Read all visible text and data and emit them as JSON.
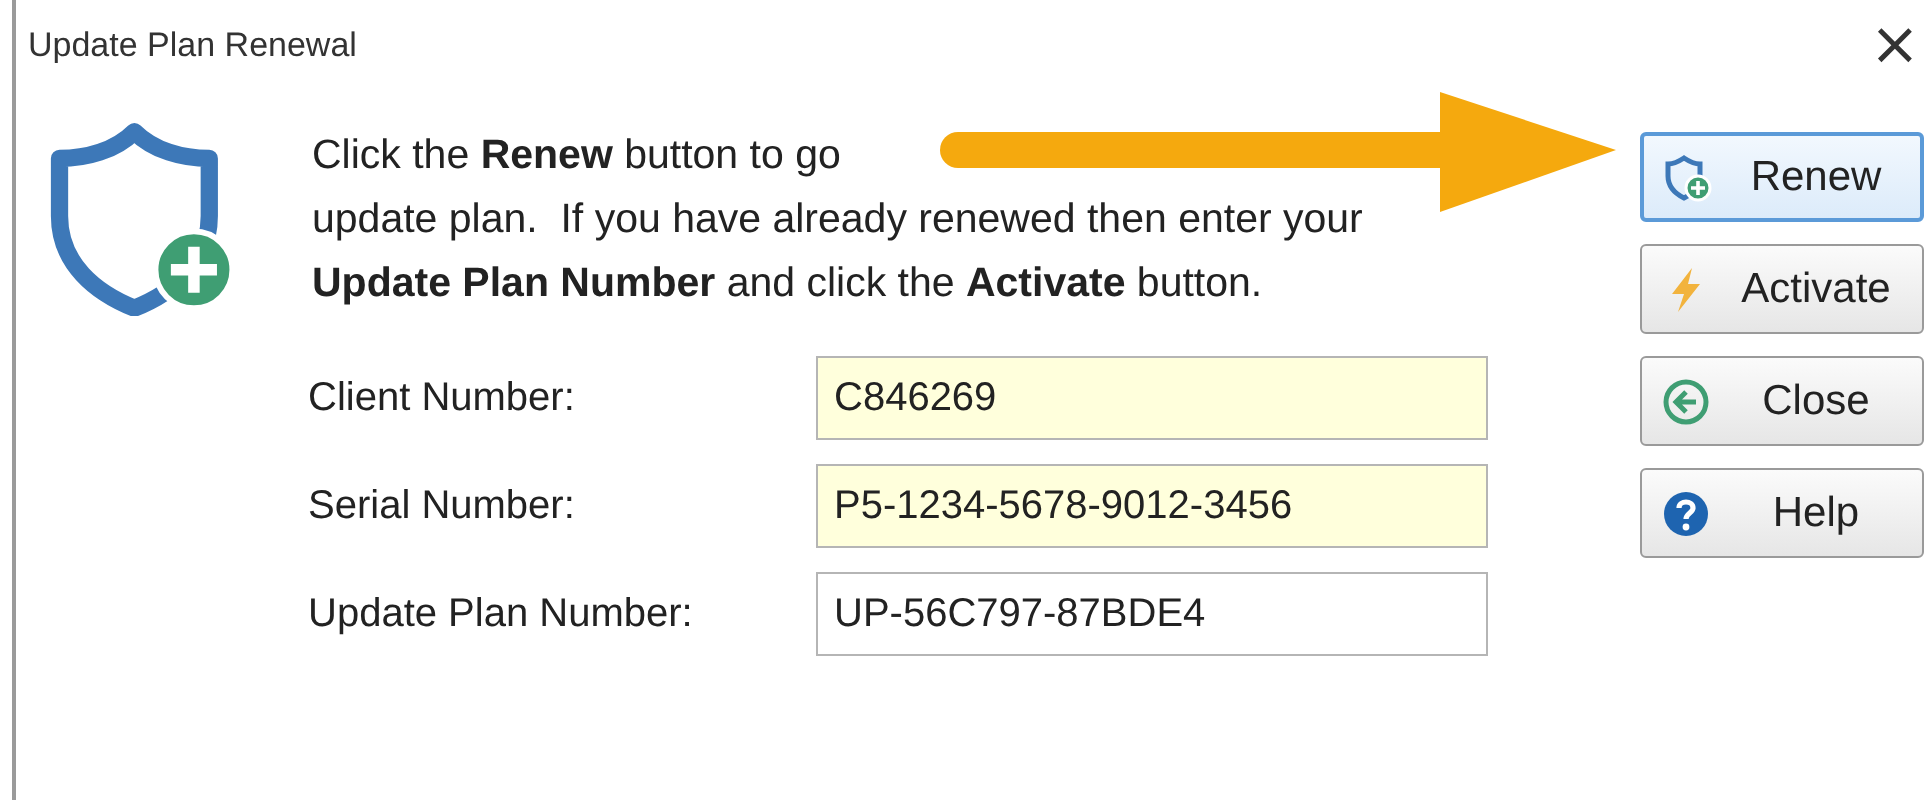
{
  "window": {
    "title": "Update Plan Renewal",
    "close": "×"
  },
  "message": [
    "Click the **Renew** button to go",
    "update plan.  If you have already renewed then enter your",
    "**Update Plan Number** and click the **Activate** button."
  ],
  "fields": [
    {
      "label": "Client Number:",
      "value": "C846269",
      "highlighted": true
    },
    {
      "label": "Serial Number:",
      "value": "P5-1234-5678-9012-3456",
      "highlighted": true
    },
    {
      "label": "Update Plan Number:",
      "value": "UP-56C797-87BDE4",
      "highlighted": false
    }
  ],
  "buttons": [
    {
      "label": "Renew",
      "kind": "renew",
      "default": true
    },
    {
      "label": "Activate",
      "kind": "activate",
      "default": false
    },
    {
      "label": "Close",
      "kind": "close",
      "default": false
    },
    {
      "label": "Help",
      "kind": "help",
      "default": false
    }
  ]
}
